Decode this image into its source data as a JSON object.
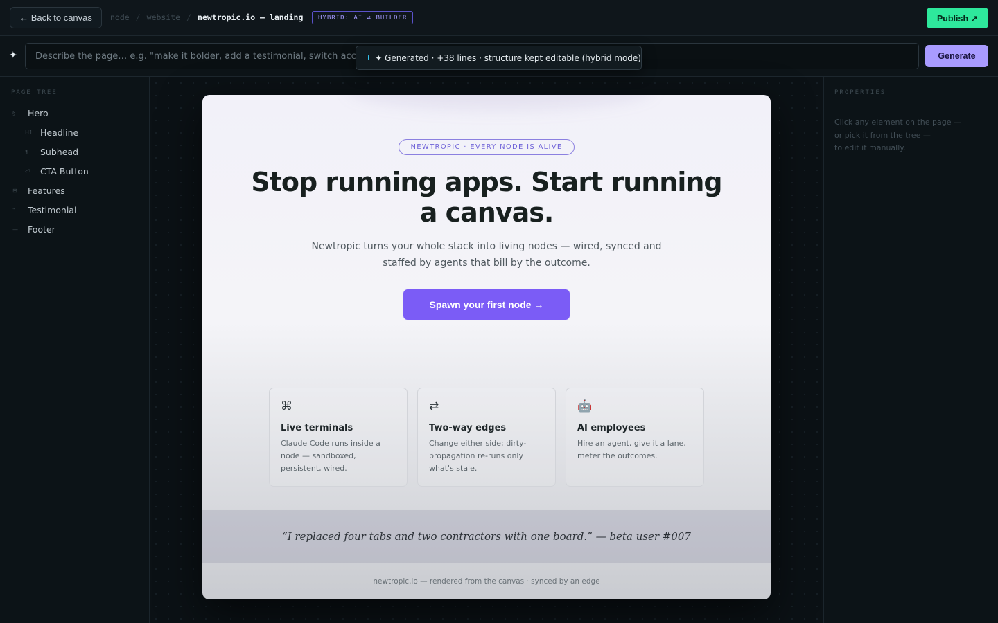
{
  "topbar": {
    "back_label": "← Back to canvas",
    "breadcrumb": [
      "node",
      "website",
      "newtropic.io — landing"
    ],
    "mode_badge": "HYBRID: AI ⇄ BUILDER",
    "publish_label": "Publish ↗"
  },
  "prompt": {
    "placeholder": "Describe the page… e.g. \"make it bolder, add a testimonial, switch accent to violet\"",
    "generate_label": "Generate"
  },
  "toast": {
    "text": "✦ Generated · +38 lines · structure kept editable (hybrid mode)"
  },
  "sidebar": {
    "title": "PAGE TREE",
    "items": [
      {
        "label": "Hero",
        "icon": "section-icon",
        "glyph": "§"
      },
      {
        "label": "Headline",
        "icon": "h1-icon",
        "glyph": "H1"
      },
      {
        "label": "Subhead",
        "icon": "paragraph-icon",
        "glyph": "¶"
      },
      {
        "label": "CTA Button",
        "icon": "link-icon",
        "glyph": "⏎"
      },
      {
        "label": "Features",
        "icon": "grid-icon",
        "glyph": "⊞"
      },
      {
        "label": "Testimonial",
        "icon": "quote-icon",
        "glyph": "\""
      },
      {
        "label": "Footer",
        "icon": "minus-icon",
        "glyph": "—"
      }
    ]
  },
  "properties": {
    "title": "PROPERTIES",
    "hint": [
      "Click any element on the page —",
      "or pick it from the tree —",
      "to edit it manually."
    ]
  },
  "preview": {
    "eyebrow": "NEWTROPIC · EVERY NODE IS ALIVE",
    "headline": "Stop running apps. Start running a canvas.",
    "subhead": "Newtropic turns your whole stack into living nodes — wired, synced and staffed by agents that bill by the outcome.",
    "cta_label": "Spawn your first node →",
    "features": [
      {
        "icon": "command-icon",
        "glyph": "⌘",
        "title": "Live terminals",
        "desc": "Claude Code runs inside a node — sandboxed, persistent, wired."
      },
      {
        "icon": "swap-icon",
        "glyph": "⇄",
        "title": "Two-way edges",
        "desc": "Change either side; dirty-propagation re-runs only what's stale."
      },
      {
        "icon": "robot-icon",
        "glyph": "🤖",
        "title": "AI employees",
        "desc": "Hire an agent, give it a lane, meter the outcomes."
      }
    ],
    "testimonial": "“I replaced four tabs and two contractors with one board.” — beta user #007",
    "footer": "newtropic.io — rendered from the canvas · synced by an edge"
  },
  "colors": {
    "accent": "#7b5cf6",
    "publish": "#2ee89c",
    "generate": "#a99bff",
    "status_dot": "#35c6f0"
  }
}
